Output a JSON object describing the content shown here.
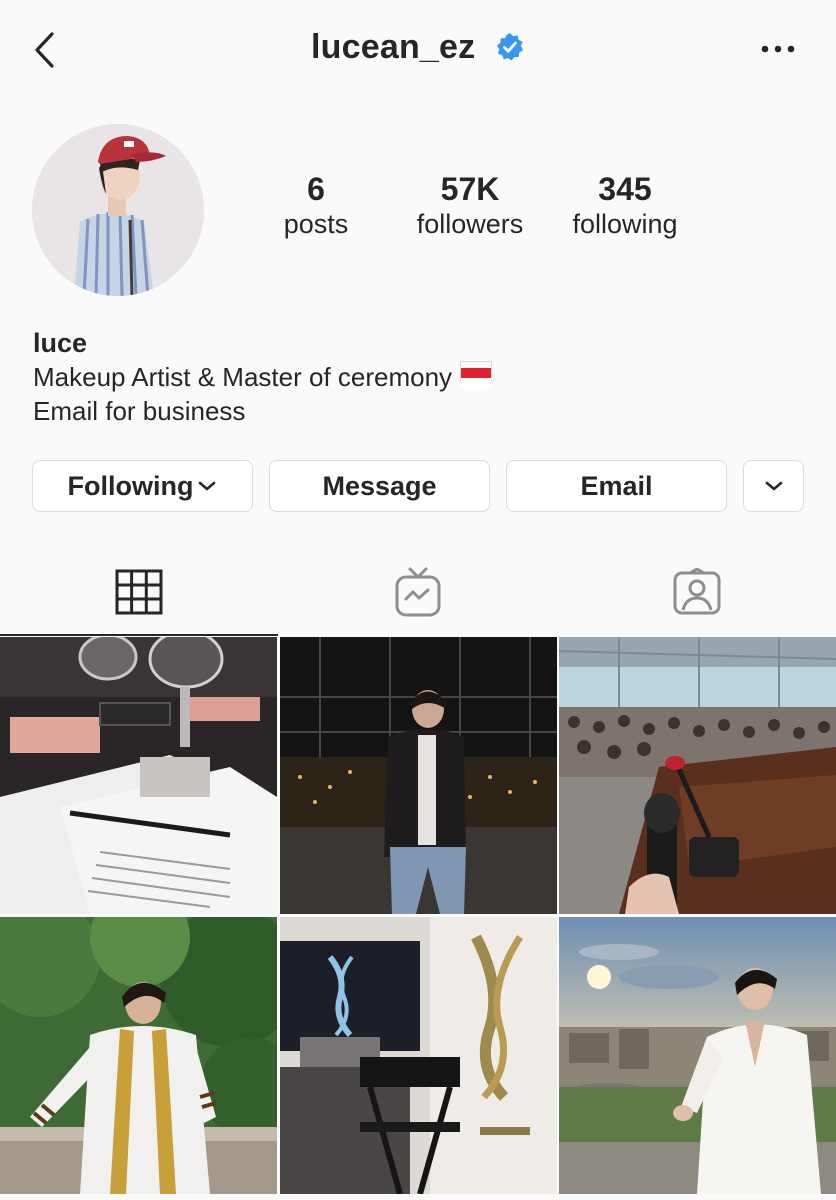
{
  "header": {
    "username": "lucean_ez",
    "verified": true,
    "icons": {
      "back": "chevron-left-icon",
      "more": "more-horizontal-icon",
      "verified": "verified-badge-icon"
    }
  },
  "profile": {
    "display_name": "luce",
    "bio_line1": "Makeup Artist & Master of ceremony",
    "bio_flag": "indonesia-flag",
    "bio_line2": "Email for business"
  },
  "stats": {
    "posts": {
      "value": "6",
      "label": "posts"
    },
    "followers": {
      "value": "57K",
      "label": "followers"
    },
    "following": {
      "value": "345",
      "label": "following"
    }
  },
  "actions": {
    "following_label": "Following",
    "message_label": "Message",
    "email_label": "Email"
  },
  "tabs": [
    {
      "name": "grid",
      "icon": "grid-icon",
      "active": true
    },
    {
      "name": "igtv",
      "icon": "igtv-icon",
      "active": false
    },
    {
      "name": "tagged",
      "icon": "tagged-person-icon",
      "active": false
    }
  ],
  "posts": [
    {
      "subject": "makeup workshop table with mirrors and palettes"
    },
    {
      "subject": "man in leather jacket on city rooftop at night"
    },
    {
      "subject": "microphone at podium before audience"
    },
    {
      "subject": "man in graduation robe among trees"
    },
    {
      "subject": "YSL Beaute display with director chair"
    },
    {
      "subject": "man in white shirt at sunset over city"
    }
  ],
  "colors": {
    "verified": "#3897f0",
    "text": "#262626",
    "border": "#dbdbdb",
    "background": "#fafafa"
  }
}
